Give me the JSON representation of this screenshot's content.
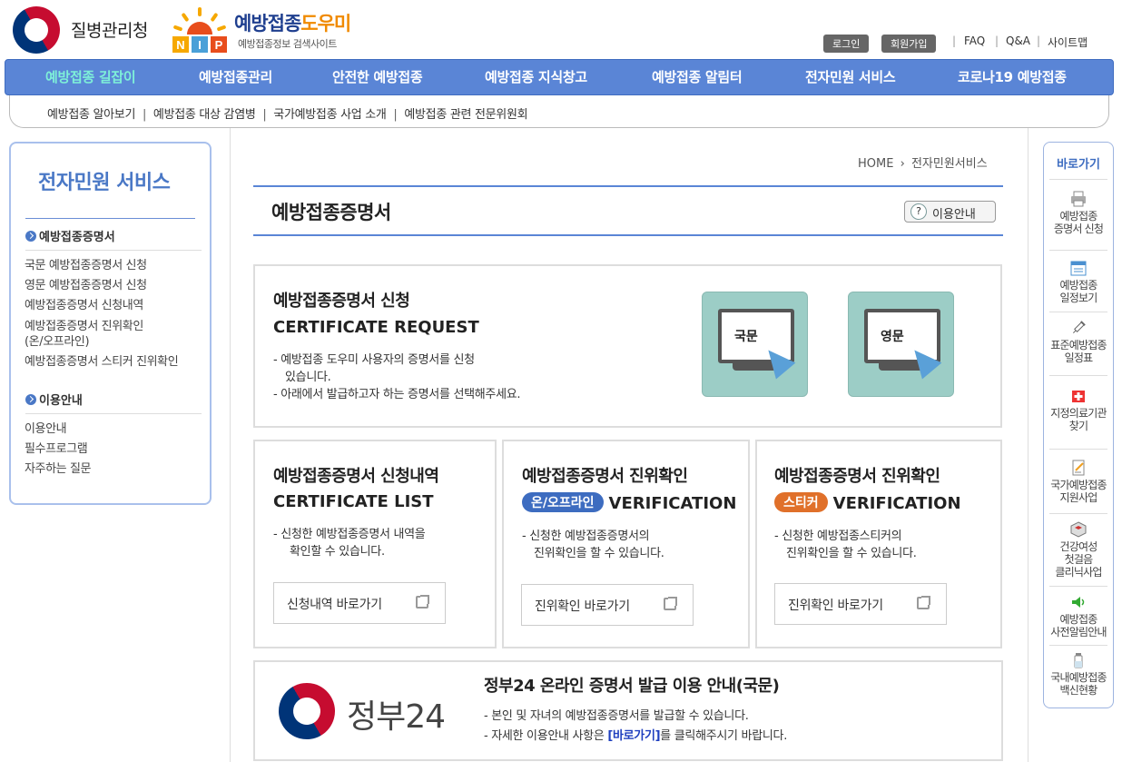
{
  "header": {
    "agency_name": "질병관리청",
    "site_name_a": "예방접종",
    "site_name_b": "도우미",
    "site_sub": "예방접종정보 검색사이트",
    "nip": "NIP",
    "util": {
      "login": "로그인",
      "join": "회원가입",
      "faq": "FAQ",
      "qa": "Q&A",
      "sitemap": "사이트맵"
    }
  },
  "gnb": [
    "예방접종 길잡이",
    "예방접종관리",
    "안전한 예방접종",
    "예방접종 지식창고",
    "예방접종 알림터",
    "전자민원 서비스",
    "코로나19 예방접종"
  ],
  "sub_nav": [
    "예방접종 알아보기",
    "예방접종 대상 감염병",
    "국가예방접종 사업 소개",
    "예방접종 관련 전문위원회"
  ],
  "lnb": {
    "title": "전자민원 서비스",
    "section1": "예방접종증명서",
    "links1": [
      "국문 예방접종증명서 신청",
      "영문 예방접종증명서 신청",
      "예방접종증명서 신청내역",
      "예방접종증명서 진위확인",
      "(온/오프라인)",
      "예방접종증명서 스티커 진위확인"
    ],
    "section2": "이용안내",
    "links2": [
      "이용안내",
      "필수프로그램",
      "자주하는 질문"
    ]
  },
  "breadcrumb": {
    "home": "HOME",
    "current": "전자민원서비스"
  },
  "page": {
    "title": "예방접종증명서",
    "guide_btn": "이용안내"
  },
  "request": {
    "title": "예방접종증명서 신청",
    "eng": "CERTIFICATE REQUEST",
    "desc1": "- 예방접종 도우미 사용자의 증명서를 신청",
    "desc1b": "있습니다.",
    "desc2": "- 아래에서 발급하고자 하는 증명서를 선택해주세요.",
    "korean": "국문",
    "english": "영문"
  },
  "cards": [
    {
      "title": "예방접종증명서 신청내역",
      "pill": "",
      "eng": "CERTIFICATE LIST",
      "desc1": "- 신청한 예방접종증명서 내역을",
      "desc2": "확인할 수 있습니다.",
      "btn": "신청내역 바로가기"
    },
    {
      "title": "예방접종증명서 진위확인",
      "pill": "온/오프라인",
      "eng": "VERIFICATION",
      "desc1": "- 신청한 예방접종증명서의",
      "desc2": "진위확인을 할 수 있습니다.",
      "btn": "진위확인 바로가기"
    },
    {
      "title": "예방접종증명서 진위확인",
      "pill": "스티커",
      "eng": "VERIFICATION",
      "desc1": "- 신청한 예방접종스티커의",
      "desc2": "진위확인을 할 수 있습니다.",
      "btn": "진위확인 바로가기"
    }
  ],
  "gov24": {
    "logo_text": "정부24",
    "title": "정부24 온라인 증명서 발급 이용 안내(국문)",
    "desc1": "- 본인 및 자녀의 예방접종증명서를 발급할 수 있습니다.",
    "desc2a": "- 자세한 이용안내 사항은 ",
    "desc2link": "[바로가기]",
    "desc2b": "를 클릭해주시기 바랍니다."
  },
  "quick": {
    "title": "바로가기",
    "items": [
      {
        "l1": "예방접종",
        "l2": "증명서 신청",
        "l3": "",
        "icon": "printer-icon"
      },
      {
        "l1": "예방접종",
        "l2": "일정보기",
        "l3": "",
        "icon": "calendar-icon"
      },
      {
        "l1": "표준예방접종",
        "l2": "일정표",
        "l3": "",
        "icon": "syringe-icon"
      },
      {
        "l1": "지정의료기관",
        "l2": "찾기",
        "l3": "",
        "icon": "hospital-icon"
      },
      {
        "l1": "국가예방접종",
        "l2": "지원사업",
        "l3": "",
        "icon": "document-icon"
      },
      {
        "l1": "건강여성",
        "l2": "첫걸음",
        "l3": "클리닉사업",
        "icon": "box-icon"
      },
      {
        "l1": "예방접종",
        "l2": "사전알림안내",
        "l3": "",
        "icon": "speaker-icon"
      },
      {
        "l1": "국내예방접종",
        "l2": "백신현황",
        "l3": "",
        "icon": "vial-icon"
      }
    ]
  },
  "colors": {
    "accent": "#5a85d6",
    "gnb_active": "#7ef0d8",
    "pill_blue": "#3d6cc0",
    "pill_orange": "#e0702a",
    "monitor": "#9ccdc6"
  }
}
